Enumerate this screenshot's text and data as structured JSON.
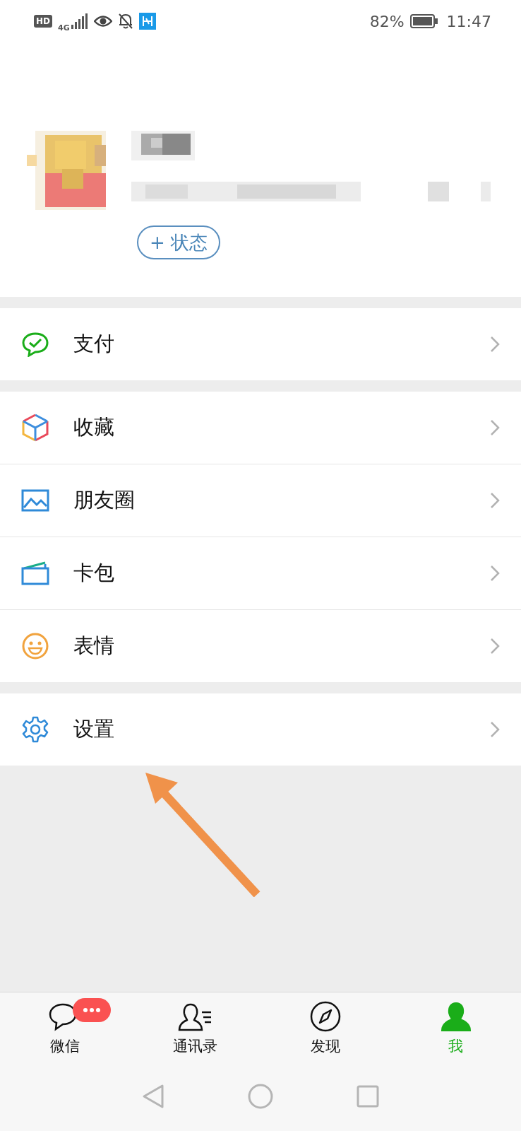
{
  "status_bar": {
    "hd": "HD",
    "network": "4G",
    "battery": "82%",
    "time": "11:47"
  },
  "profile": {
    "status_button": "+ 状态"
  },
  "sections": [
    [
      {
        "label": "支付",
        "kind": "pay"
      }
    ],
    [
      {
        "label": "收藏",
        "kind": "favorites"
      },
      {
        "label": "朋友圈",
        "kind": "moments"
      },
      {
        "label": "卡包",
        "kind": "cards"
      },
      {
        "label": "表情",
        "kind": "stickers"
      }
    ],
    [
      {
        "label": "设置",
        "kind": "settings"
      }
    ]
  ],
  "annotation": {
    "kind": "arrow"
  },
  "tabs": [
    {
      "label": "微信",
      "kind": "chats",
      "selected": false,
      "badge": true
    },
    {
      "label": "通讯录",
      "kind": "contacts",
      "selected": false,
      "badge": false
    },
    {
      "label": "发现",
      "kind": "discover",
      "selected": false,
      "badge": false
    },
    {
      "label": "我",
      "kind": "me",
      "selected": true,
      "badge": false
    }
  ]
}
